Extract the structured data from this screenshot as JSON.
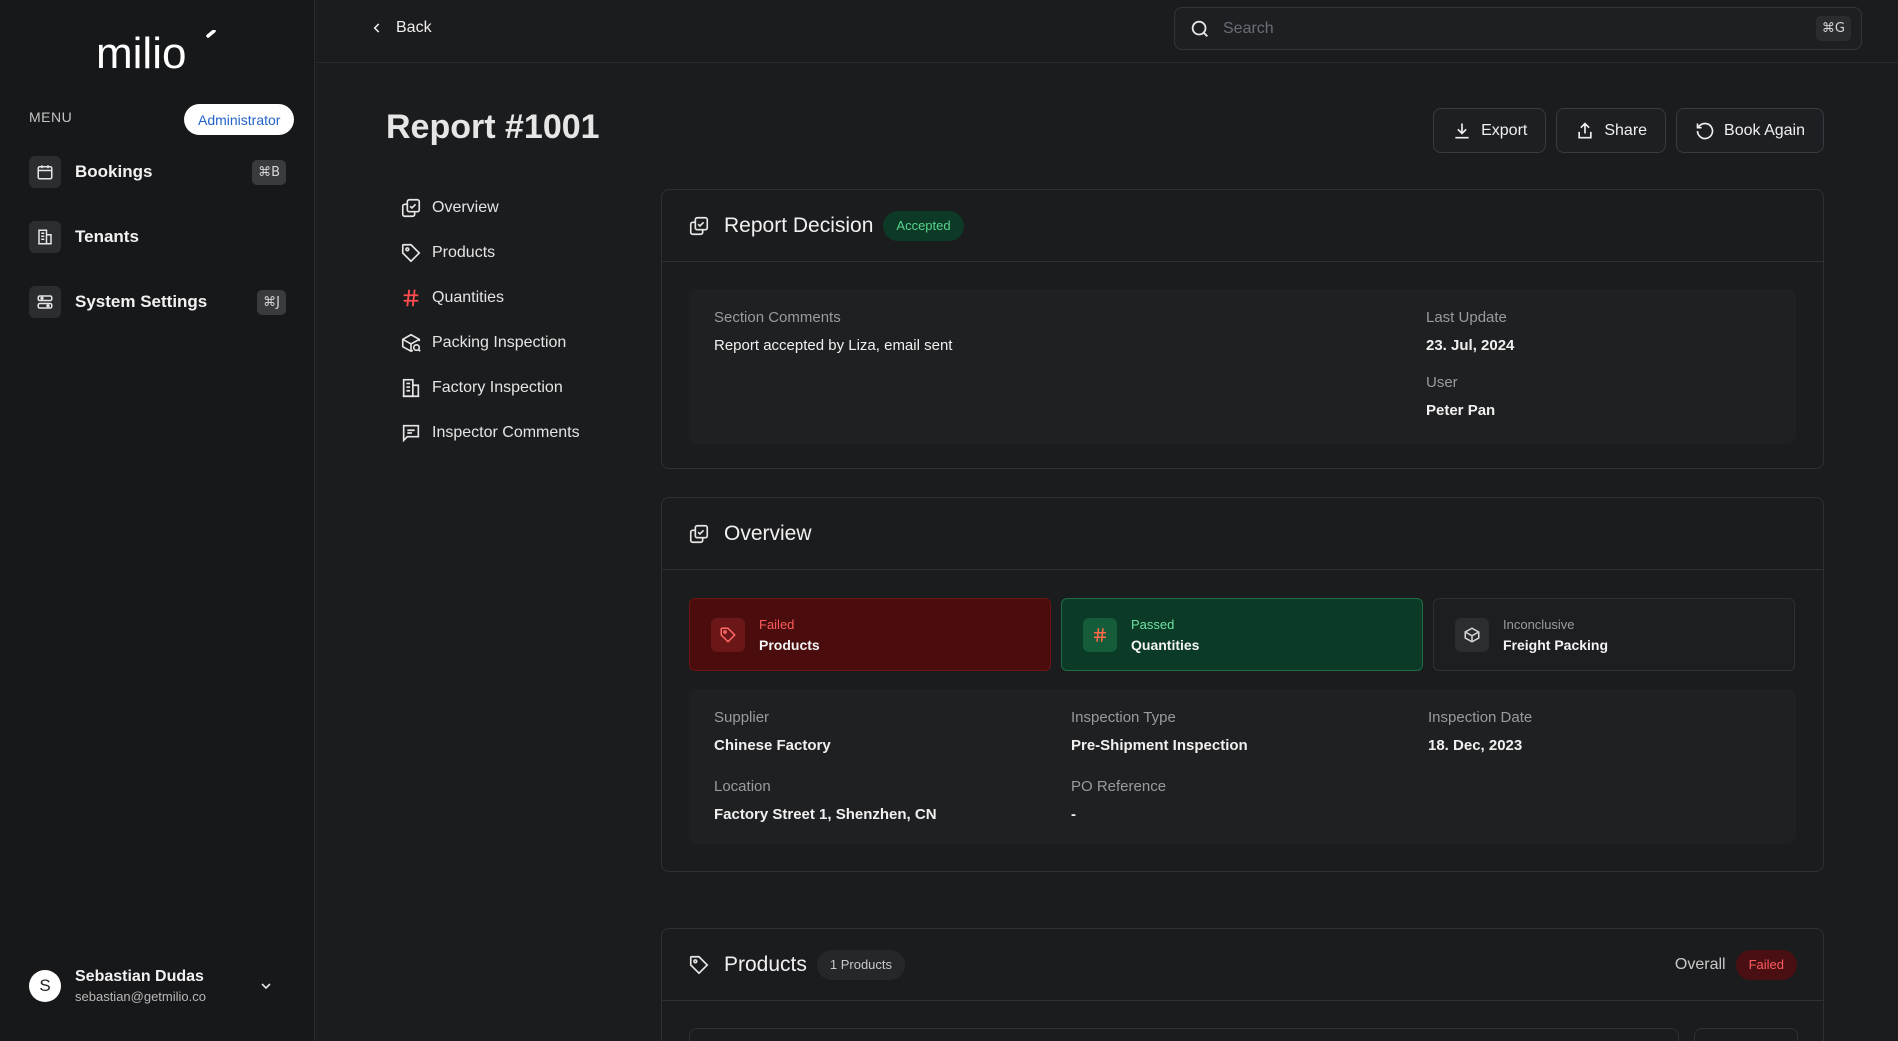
{
  "app": {
    "brand": "milio"
  },
  "sidebar": {
    "menu_label": "MENU",
    "role": "Administrator",
    "items": [
      {
        "label": "Bookings",
        "shortcut": "⌘B",
        "icon": "calendar-icon"
      },
      {
        "label": "Tenants",
        "shortcut": "",
        "icon": "building-icon"
      },
      {
        "label": "System Settings",
        "shortcut": "⌘J",
        "icon": "settings-icon"
      }
    ],
    "user": {
      "initial": "S",
      "name": "Sebastian Dudas",
      "email": "sebastian@getmilio.co"
    }
  },
  "topbar": {
    "back_label": "Back",
    "search_placeholder": "Search",
    "search_shortcut": "⌘G"
  },
  "header": {
    "title": "Report #1001",
    "actions": {
      "export": "Export",
      "share": "Share",
      "book_again": "Book Again"
    }
  },
  "section_nav": [
    {
      "label": "Overview",
      "icon": "overview-icon"
    },
    {
      "label": "Products",
      "icon": "tag-icon"
    },
    {
      "label": "Quantities",
      "icon": "hash-icon"
    },
    {
      "label": "Packing Inspection",
      "icon": "package-search-icon"
    },
    {
      "label": "Factory Inspection",
      "icon": "factory-icon"
    },
    {
      "label": "Inspector Comments",
      "icon": "comment-icon"
    }
  ],
  "decision": {
    "title": "Report Decision",
    "status": "Accepted",
    "comments_label": "Section Comments",
    "comments_value": "Report accepted by Liza, email sent",
    "last_update_label": "Last Update",
    "last_update_value": "23. Jul, 2024",
    "user_label": "User",
    "user_value": "Peter Pan"
  },
  "overview": {
    "title": "Overview",
    "tiles": [
      {
        "status": "Failed",
        "label": "Products"
      },
      {
        "status": "Passed",
        "label": "Quantities"
      },
      {
        "status": "Inconclusive",
        "label": "Freight Packing"
      }
    ],
    "supplier_label": "Supplier",
    "supplier_value": "Chinese Factory",
    "type_label": "Inspection Type",
    "type_value": "Pre-Shipment Inspection",
    "date_label": "Inspection Date",
    "date_value": "18. Dec, 2023",
    "location_label": "Location",
    "location_value": "Factory Street 1, Shenzhen, CN",
    "po_label": "PO Reference",
    "po_value": "-"
  },
  "products": {
    "title": "Products",
    "count": "1 Products",
    "overall_label": "Overall",
    "overall_status": "Failed"
  },
  "colors": {
    "accent_green": "#58d38e",
    "accent_red": "#ff5a5f",
    "role_blue": "#2563c9"
  }
}
